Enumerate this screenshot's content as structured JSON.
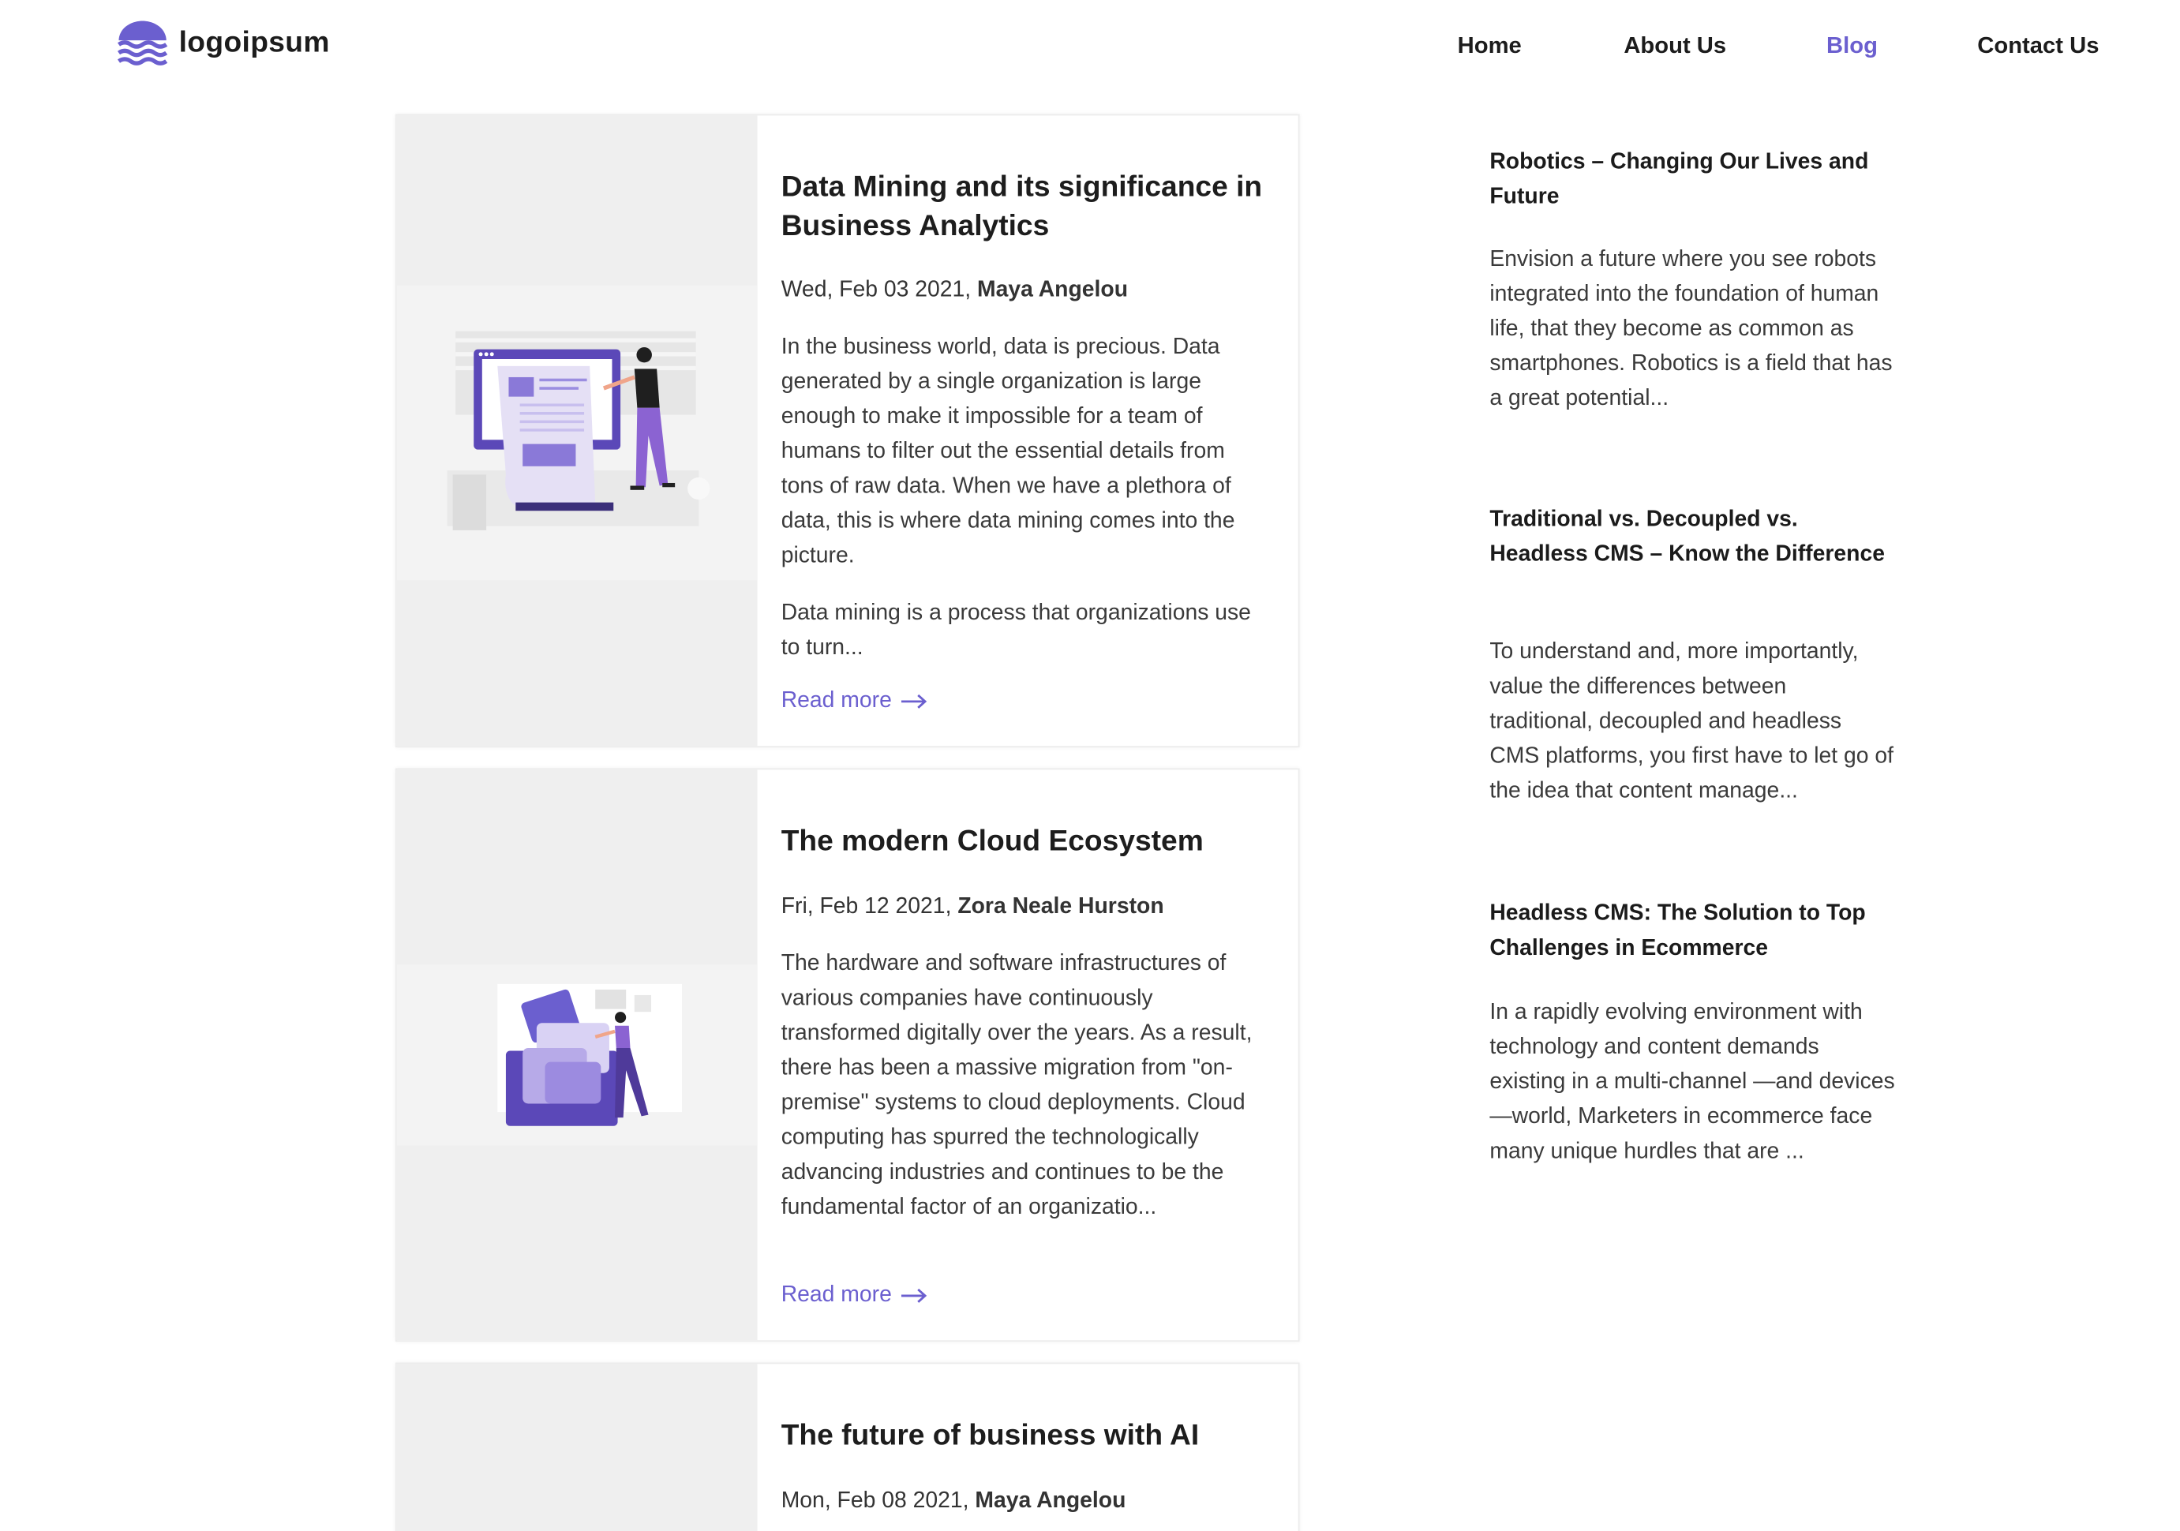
{
  "brand": {
    "name": "logoipsum",
    "accent": "#6b5fcf"
  },
  "nav": [
    {
      "label": "Home",
      "active": false
    },
    {
      "label": "About Us",
      "active": false
    },
    {
      "label": "Blog",
      "active": true
    },
    {
      "label": "Contact Us",
      "active": false
    }
  ],
  "posts": [
    {
      "title": "Data Mining and its significance in Business Analytics",
      "date": "Wed, Feb 03 2021,",
      "author": "Maya Angelou",
      "excerpt1": "In the business world, data is precious. Data generated by a single organization is large enough to make it impossible for a team of humans to filter out the essential details from tons of raw data. When we have a plethora of data, this is where data mining comes into the picture.",
      "excerpt2": "Data mining is a process that organizations use to turn...",
      "read_more": "Read more"
    },
    {
      "title": "The modern Cloud Ecosystem",
      "date": "Fri, Feb 12 2021,",
      "author": "Zora Neale Hurston",
      "excerpt1": "The hardware and software infrastructures of various companies have continuously transformed digitally over the years. As a result, there has been a massive migration from \"on-premise\" systems to cloud deployments. Cloud computing has spurred the technologically advancing industries and continues to be the fundamental factor of an organizatio...",
      "read_more": "Read more"
    },
    {
      "title": "The future of business with AI",
      "date": "Mon, Feb 08 2021,",
      "author": "Maya Angelou"
    }
  ],
  "sidebar": [
    {
      "title": "Robotics – Changing Our Lives and Future",
      "text": "Envision a future where you see robots integrated into the foundation of human life, that they become as common as smartphones. Robotics is a field that has a great potential..."
    },
    {
      "title": "Traditional vs. Decoupled vs. Headless CMS – Know the Difference",
      "text": "To understand and, more importantly, value the differences between traditional, decoupled and headless CMS platforms, you first have to let go of the idea that content manage..."
    },
    {
      "title": "Headless CMS: The Solution to Top Challenges in Ecommerce",
      "text": "In a rapidly evolving environment with technology and content demands existing in a multi-channel —and devices—world, Marketers in ecommerce face many unique hurdles that are ..."
    }
  ]
}
